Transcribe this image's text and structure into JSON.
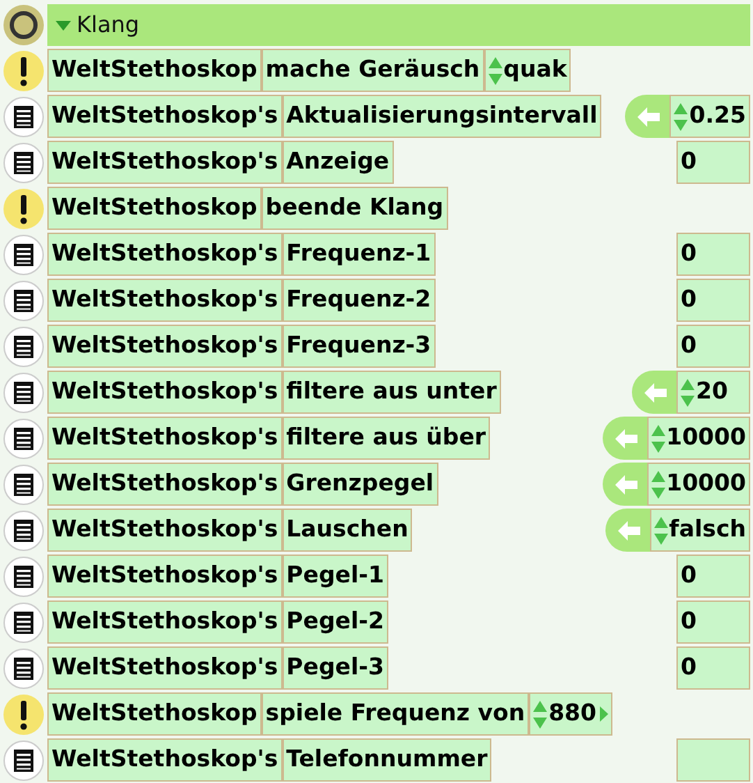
{
  "header": {
    "title": "Klang",
    "expanded": true
  },
  "rows": [
    {
      "kind": "command",
      "object": "WeltStethoskop",
      "label": "mache Geräusch",
      "argument": "quak",
      "extendable": false
    },
    {
      "kind": "property",
      "object": "WeltStethoskop's",
      "label": "Aktualisierungsintervall",
      "value": "0.25",
      "settable": true
    },
    {
      "kind": "property",
      "object": "WeltStethoskop's",
      "label": "Anzeige",
      "value": "0",
      "settable": false
    },
    {
      "kind": "command",
      "object": "WeltStethoskop",
      "label": "beende Klang"
    },
    {
      "kind": "property",
      "object": "WeltStethoskop's",
      "label": "Frequenz-1",
      "value": "0",
      "settable": false
    },
    {
      "kind": "property",
      "object": "WeltStethoskop's",
      "label": "Frequenz-2",
      "value": "0",
      "settable": false
    },
    {
      "kind": "property",
      "object": "WeltStethoskop's",
      "label": "Frequenz-3",
      "value": "0",
      "settable": false
    },
    {
      "kind": "property",
      "object": "WeltStethoskop's",
      "label": "filtere aus unter",
      "value": "20",
      "settable": true
    },
    {
      "kind": "property",
      "object": "WeltStethoskop's",
      "label": "filtere aus über",
      "value": "10000",
      "settable": true
    },
    {
      "kind": "property",
      "object": "WeltStethoskop's",
      "label": "Grenzpegel",
      "value": "10000",
      "settable": true
    },
    {
      "kind": "property",
      "object": "WeltStethoskop's",
      "label": "Lauschen",
      "value": "falsch",
      "settable": true
    },
    {
      "kind": "property",
      "object": "WeltStethoskop's",
      "label": "Pegel-1",
      "value": "0",
      "settable": false
    },
    {
      "kind": "property",
      "object": "WeltStethoskop's",
      "label": "Pegel-2",
      "value": "0",
      "settable": false
    },
    {
      "kind": "property",
      "object": "WeltStethoskop's",
      "label": "Pegel-3",
      "value": "0",
      "settable": false
    },
    {
      "kind": "command",
      "object": "WeltStethoskop",
      "label": "spiele Frequenz von",
      "argument": "880",
      "extendable": true
    },
    {
      "kind": "property",
      "object": "WeltStethoskop's",
      "label": "Telefonnummer",
      "settable": false
    }
  ]
}
